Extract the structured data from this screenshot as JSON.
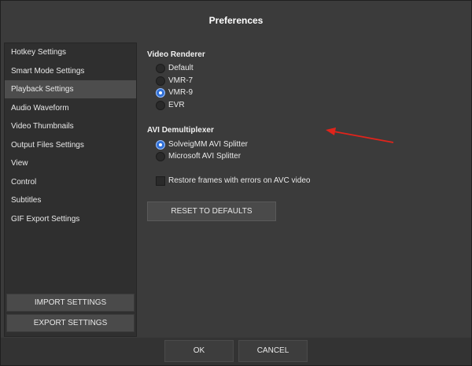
{
  "window": {
    "title": "Preferences"
  },
  "sidebar": {
    "items": [
      {
        "label": "Hotkey Settings"
      },
      {
        "label": "Smart Mode Settings"
      },
      {
        "label": "Playback Settings"
      },
      {
        "label": "Audio Waveform"
      },
      {
        "label": "Video Thumbnails"
      },
      {
        "label": "Output Files Settings"
      },
      {
        "label": "View"
      },
      {
        "label": "Control"
      },
      {
        "label": "Subtitles"
      },
      {
        "label": "GIF Export Settings"
      }
    ],
    "selected": "Playback Settings",
    "import_label": "IMPORT SETTINGS",
    "export_label": "EXPORT SETTINGS"
  },
  "video_renderer": {
    "title": "Video Renderer",
    "options": [
      {
        "label": "Default"
      },
      {
        "label": "VMR-7"
      },
      {
        "label": "VMR-9"
      },
      {
        "label": "EVR"
      }
    ],
    "selected": "VMR-9"
  },
  "avi_demux": {
    "title": "AVI Demultiplexer",
    "options": [
      {
        "label": "SolveigMM AVI Splitter"
      },
      {
        "label": "Microsoft AVI Splitter"
      }
    ],
    "selected": "SolveigMM AVI Splitter"
  },
  "restore_frames": {
    "label": "Restore frames with errors on AVC video",
    "checked": false
  },
  "reset_label": "RESET TO DEFAULTS",
  "footer": {
    "ok_label": "OK",
    "cancel_label": "CANCEL"
  },
  "colors": {
    "accent": "#2f6fd6",
    "arrow": "#e0241b"
  }
}
